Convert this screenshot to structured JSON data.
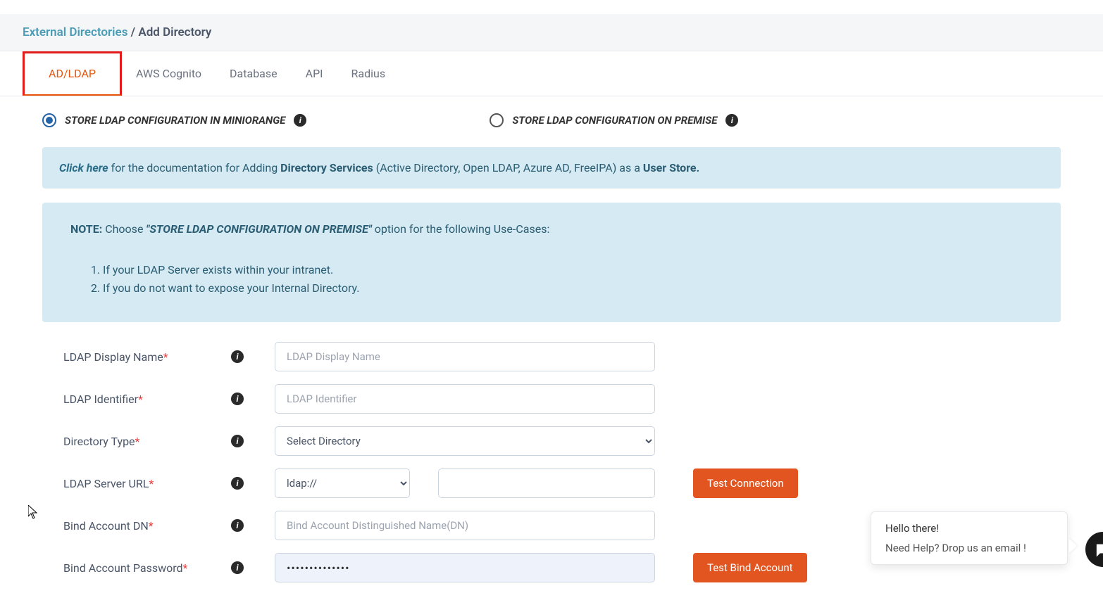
{
  "breadcrumb": {
    "link": "External Directories",
    "current": "Add Directory",
    "sep": " / "
  },
  "tabs": [
    {
      "label": "AD/LDAP"
    },
    {
      "label": "AWS Cognito"
    },
    {
      "label": "Database"
    },
    {
      "label": "API"
    },
    {
      "label": "Radius"
    }
  ],
  "radio": {
    "opt1": "STORE LDAP CONFIGURATION IN MINIORANGE",
    "opt2": "STORE LDAP CONFIGURATION ON PREMISE"
  },
  "doc": {
    "click_here": "Click here",
    "text1": " for the documentation for Adding ",
    "bold1": "Directory Services",
    "text2": " (Active Directory, Open LDAP, Azure AD, FreeIPA) as a ",
    "bold2": "User Store."
  },
  "note": {
    "prefix": "NOTE:",
    "choose": "  Choose ",
    "option": "\"STORE LDAP CONFIGURATION ON PREMISE\"",
    "suffix": " option for the following Use-Cases:",
    "item1": "If your LDAP Server exists within your intranet.",
    "item2": "If you do not want to expose your Internal Directory."
  },
  "form": {
    "display_name": {
      "label": "LDAP Display Name",
      "placeholder": "LDAP Display Name"
    },
    "identifier": {
      "label": "LDAP Identifier",
      "placeholder": "LDAP Identifier"
    },
    "directory_type": {
      "label": "Directory Type",
      "selected": "Select Directory"
    },
    "server_url": {
      "label": "LDAP Server URL",
      "protocol": "ldap://"
    },
    "bind_dn": {
      "label": "Bind Account DN",
      "placeholder": "Bind Account Distinguished Name(DN)"
    },
    "bind_pw": {
      "label": "Bind Account Password",
      "value": "••••••••••••••"
    }
  },
  "buttons": {
    "test_connection": "Test Connection",
    "test_bind": "Test Bind Account"
  },
  "chat": {
    "line1": "Hello there!",
    "line2": "Need Help? Drop us an email !"
  }
}
